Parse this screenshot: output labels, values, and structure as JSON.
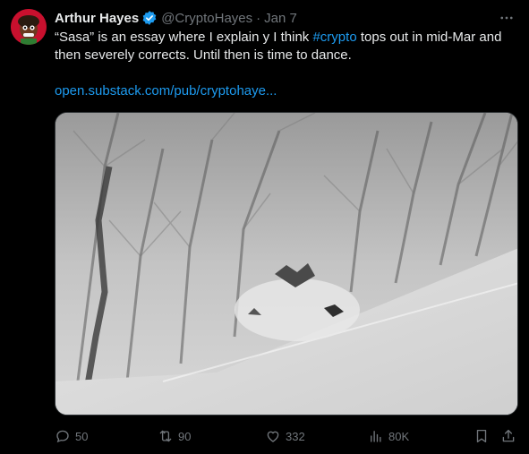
{
  "author": {
    "name": "Arthur Hayes",
    "handle": "@CryptoHayes",
    "separator": "·",
    "date": "Jan 7"
  },
  "tweet": {
    "line1_before": "“Sasa” is an essay where I explain y I think ",
    "hashtag": "#crypto",
    "line1_after": " tops out in mid-Mar and",
    "line2": "then severely corrects. Until then is time to dance.",
    "link": "open.substack.com/pub/cryptohaye..."
  },
  "actions": {
    "replies": "50",
    "reposts": "90",
    "likes": "332",
    "views": "80K"
  },
  "colors": {
    "accent": "#1d9bf0",
    "muted": "#71767b",
    "text": "#e7e9ea",
    "background": "#000000"
  },
  "icons": [
    "verified-badge-icon",
    "more-icon",
    "reply-icon",
    "repost-icon",
    "like-icon",
    "views-icon",
    "bookmark-icon",
    "share-icon"
  ]
}
